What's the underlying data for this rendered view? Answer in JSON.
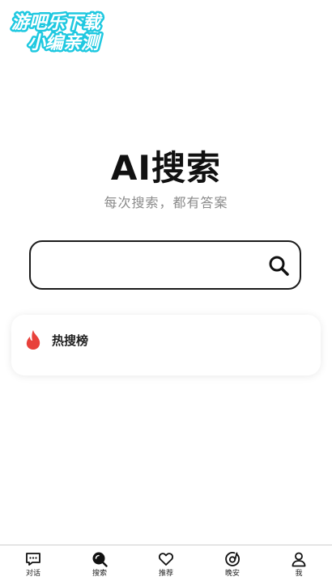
{
  "watermark": {
    "line1": "游吧乐下载",
    "line2": "小编亲测"
  },
  "hero": {
    "title": "AI搜索",
    "subtitle": "每次搜索，都有答案"
  },
  "search": {
    "placeholder": "",
    "value": "",
    "icon": "search-icon"
  },
  "hot_list": {
    "icon": "fire-icon",
    "label": "热搜榜"
  },
  "bottom_nav": {
    "items": [
      {
        "label": "对话",
        "icon": "chat-icon"
      },
      {
        "label": "搜索",
        "icon": "search-nav-icon"
      },
      {
        "label": "推荐",
        "icon": "heart-icon"
      },
      {
        "label": "晚安",
        "icon": "music-disc-icon"
      },
      {
        "label": "我",
        "icon": "user-icon"
      }
    ]
  },
  "colors": {
    "accent_fire": "#e8413b",
    "text_primary": "#111111",
    "text_secondary": "#8a8a8a",
    "watermark_fill": "#ffffff",
    "watermark_stroke": "#1ec8e0"
  }
}
